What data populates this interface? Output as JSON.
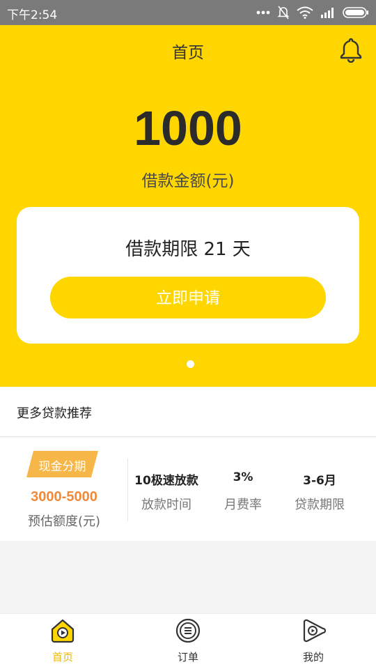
{
  "status_bar": {
    "time": "下午2:54"
  },
  "header": {
    "title": "首页"
  },
  "loan": {
    "amount": "1000",
    "amount_label": "借款金额(元)",
    "term_text": "借款期限 21 天",
    "apply_label": "立即申请"
  },
  "carousel": {
    "page_count": 1,
    "active_index": 0
  },
  "recommend": {
    "title": "更多贷款推荐"
  },
  "product": {
    "tag": "现金分期",
    "range": "3000-5000",
    "range_label": "预估额度(元)",
    "stats": [
      {
        "value": "10极速放款",
        "label": "放款时间"
      },
      {
        "value": "3%",
        "label": "月费率"
      },
      {
        "value": "3-6月",
        "label": "贷款期限"
      }
    ]
  },
  "nav": {
    "items": [
      {
        "label": "首页",
        "icon": "home-play-icon",
        "active": true
      },
      {
        "label": "订单",
        "icon": "order-list-icon",
        "active": false
      },
      {
        "label": "我的",
        "icon": "profile-play-icon",
        "active": false
      }
    ]
  },
  "colors": {
    "brand": "#ffd600",
    "accent_orange": "#f08a3a",
    "tag_orange": "#f7b648",
    "nav_active": "#f0b800"
  }
}
